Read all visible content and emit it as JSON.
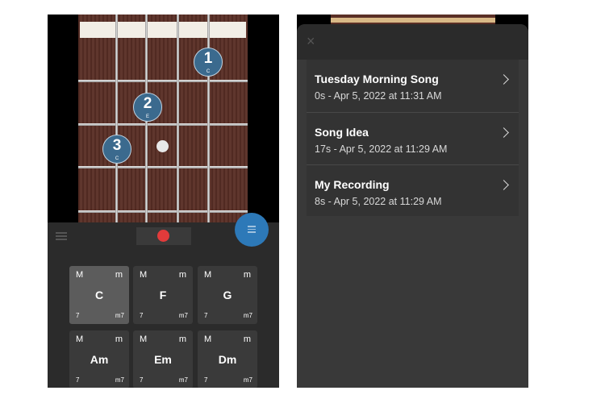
{
  "fretboard": {
    "fingers": [
      {
        "number": "1",
        "note": "C"
      },
      {
        "number": "2",
        "note": "E"
      },
      {
        "number": "3",
        "note": "C"
      }
    ]
  },
  "chords": [
    {
      "major": "M",
      "minor": "m",
      "name": "C",
      "seventh": "7",
      "minor7": "m7"
    },
    {
      "major": "M",
      "minor": "m",
      "name": "F",
      "seventh": "7",
      "minor7": "m7"
    },
    {
      "major": "M",
      "minor": "m",
      "name": "G",
      "seventh": "7",
      "minor7": "m7"
    },
    {
      "major": "M",
      "minor": "m",
      "name": "Am",
      "seventh": "7",
      "minor7": "m7"
    },
    {
      "major": "M",
      "minor": "m",
      "name": "Em",
      "seventh": "7",
      "minor7": "m7"
    },
    {
      "major": "M",
      "minor": "m",
      "name": "Dm",
      "seventh": "7",
      "minor7": "m7"
    }
  ],
  "recordings": [
    {
      "title": "Tuesday Morning Song",
      "meta": "0s - Apr 5, 2022 at 11:31 AM"
    },
    {
      "title": "Song Idea",
      "meta": "17s - Apr 5, 2022 at 11:29 AM"
    },
    {
      "title": "My Recording",
      "meta": "8s - Apr 5, 2022 at 11:29 AM"
    }
  ],
  "close_glyph": "×",
  "icons": {
    "close": "close-icon",
    "menu": "menu-icon",
    "chevron": "chevron-right-icon",
    "record": "record-icon"
  },
  "colors": {
    "record": "#e23b3b",
    "fab": "#2d79b8",
    "finger": "#3b6a8e"
  }
}
